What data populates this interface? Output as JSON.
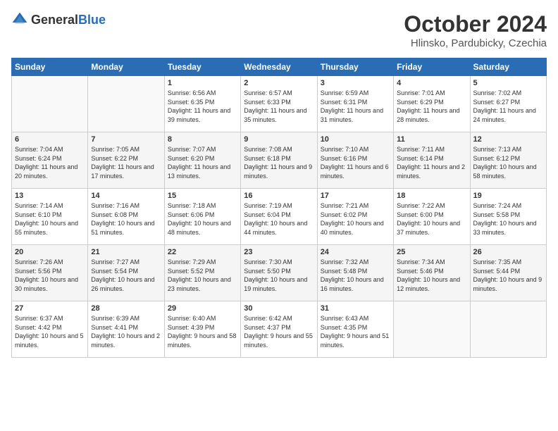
{
  "logo": {
    "general": "General",
    "blue": "Blue"
  },
  "header": {
    "title": "October 2024",
    "subtitle": "Hlinsko, Pardubicky, Czechia"
  },
  "days_of_week": [
    "Sunday",
    "Monday",
    "Tuesday",
    "Wednesday",
    "Thursday",
    "Friday",
    "Saturday"
  ],
  "weeks": [
    [
      {
        "num": "",
        "sunrise": "",
        "sunset": "",
        "daylight": ""
      },
      {
        "num": "",
        "sunrise": "",
        "sunset": "",
        "daylight": ""
      },
      {
        "num": "1",
        "sunrise": "Sunrise: 6:56 AM",
        "sunset": "Sunset: 6:35 PM",
        "daylight": "Daylight: 11 hours and 39 minutes."
      },
      {
        "num": "2",
        "sunrise": "Sunrise: 6:57 AM",
        "sunset": "Sunset: 6:33 PM",
        "daylight": "Daylight: 11 hours and 35 minutes."
      },
      {
        "num": "3",
        "sunrise": "Sunrise: 6:59 AM",
        "sunset": "Sunset: 6:31 PM",
        "daylight": "Daylight: 11 hours and 31 minutes."
      },
      {
        "num": "4",
        "sunrise": "Sunrise: 7:01 AM",
        "sunset": "Sunset: 6:29 PM",
        "daylight": "Daylight: 11 hours and 28 minutes."
      },
      {
        "num": "5",
        "sunrise": "Sunrise: 7:02 AM",
        "sunset": "Sunset: 6:27 PM",
        "daylight": "Daylight: 11 hours and 24 minutes."
      }
    ],
    [
      {
        "num": "6",
        "sunrise": "Sunrise: 7:04 AM",
        "sunset": "Sunset: 6:24 PM",
        "daylight": "Daylight: 11 hours and 20 minutes."
      },
      {
        "num": "7",
        "sunrise": "Sunrise: 7:05 AM",
        "sunset": "Sunset: 6:22 PM",
        "daylight": "Daylight: 11 hours and 17 minutes."
      },
      {
        "num": "8",
        "sunrise": "Sunrise: 7:07 AM",
        "sunset": "Sunset: 6:20 PM",
        "daylight": "Daylight: 11 hours and 13 minutes."
      },
      {
        "num": "9",
        "sunrise": "Sunrise: 7:08 AM",
        "sunset": "Sunset: 6:18 PM",
        "daylight": "Daylight: 11 hours and 9 minutes."
      },
      {
        "num": "10",
        "sunrise": "Sunrise: 7:10 AM",
        "sunset": "Sunset: 6:16 PM",
        "daylight": "Daylight: 11 hours and 6 minutes."
      },
      {
        "num": "11",
        "sunrise": "Sunrise: 7:11 AM",
        "sunset": "Sunset: 6:14 PM",
        "daylight": "Daylight: 11 hours and 2 minutes."
      },
      {
        "num": "12",
        "sunrise": "Sunrise: 7:13 AM",
        "sunset": "Sunset: 6:12 PM",
        "daylight": "Daylight: 10 hours and 58 minutes."
      }
    ],
    [
      {
        "num": "13",
        "sunrise": "Sunrise: 7:14 AM",
        "sunset": "Sunset: 6:10 PM",
        "daylight": "Daylight: 10 hours and 55 minutes."
      },
      {
        "num": "14",
        "sunrise": "Sunrise: 7:16 AM",
        "sunset": "Sunset: 6:08 PM",
        "daylight": "Daylight: 10 hours and 51 minutes."
      },
      {
        "num": "15",
        "sunrise": "Sunrise: 7:18 AM",
        "sunset": "Sunset: 6:06 PM",
        "daylight": "Daylight: 10 hours and 48 minutes."
      },
      {
        "num": "16",
        "sunrise": "Sunrise: 7:19 AM",
        "sunset": "Sunset: 6:04 PM",
        "daylight": "Daylight: 10 hours and 44 minutes."
      },
      {
        "num": "17",
        "sunrise": "Sunrise: 7:21 AM",
        "sunset": "Sunset: 6:02 PM",
        "daylight": "Daylight: 10 hours and 40 minutes."
      },
      {
        "num": "18",
        "sunrise": "Sunrise: 7:22 AM",
        "sunset": "Sunset: 6:00 PM",
        "daylight": "Daylight: 10 hours and 37 minutes."
      },
      {
        "num": "19",
        "sunrise": "Sunrise: 7:24 AM",
        "sunset": "Sunset: 5:58 PM",
        "daylight": "Daylight: 10 hours and 33 minutes."
      }
    ],
    [
      {
        "num": "20",
        "sunrise": "Sunrise: 7:26 AM",
        "sunset": "Sunset: 5:56 PM",
        "daylight": "Daylight: 10 hours and 30 minutes."
      },
      {
        "num": "21",
        "sunrise": "Sunrise: 7:27 AM",
        "sunset": "Sunset: 5:54 PM",
        "daylight": "Daylight: 10 hours and 26 minutes."
      },
      {
        "num": "22",
        "sunrise": "Sunrise: 7:29 AM",
        "sunset": "Sunset: 5:52 PM",
        "daylight": "Daylight: 10 hours and 23 minutes."
      },
      {
        "num": "23",
        "sunrise": "Sunrise: 7:30 AM",
        "sunset": "Sunset: 5:50 PM",
        "daylight": "Daylight: 10 hours and 19 minutes."
      },
      {
        "num": "24",
        "sunrise": "Sunrise: 7:32 AM",
        "sunset": "Sunset: 5:48 PM",
        "daylight": "Daylight: 10 hours and 16 minutes."
      },
      {
        "num": "25",
        "sunrise": "Sunrise: 7:34 AM",
        "sunset": "Sunset: 5:46 PM",
        "daylight": "Daylight: 10 hours and 12 minutes."
      },
      {
        "num": "26",
        "sunrise": "Sunrise: 7:35 AM",
        "sunset": "Sunset: 5:44 PM",
        "daylight": "Daylight: 10 hours and 9 minutes."
      }
    ],
    [
      {
        "num": "27",
        "sunrise": "Sunrise: 6:37 AM",
        "sunset": "Sunset: 4:42 PM",
        "daylight": "Daylight: 10 hours and 5 minutes."
      },
      {
        "num": "28",
        "sunrise": "Sunrise: 6:39 AM",
        "sunset": "Sunset: 4:41 PM",
        "daylight": "Daylight: 10 hours and 2 minutes."
      },
      {
        "num": "29",
        "sunrise": "Sunrise: 6:40 AM",
        "sunset": "Sunset: 4:39 PM",
        "daylight": "Daylight: 9 hours and 58 minutes."
      },
      {
        "num": "30",
        "sunrise": "Sunrise: 6:42 AM",
        "sunset": "Sunset: 4:37 PM",
        "daylight": "Daylight: 9 hours and 55 minutes."
      },
      {
        "num": "31",
        "sunrise": "Sunrise: 6:43 AM",
        "sunset": "Sunset: 4:35 PM",
        "daylight": "Daylight: 9 hours and 51 minutes."
      },
      {
        "num": "",
        "sunrise": "",
        "sunset": "",
        "daylight": ""
      },
      {
        "num": "",
        "sunrise": "",
        "sunset": "",
        "daylight": ""
      }
    ]
  ]
}
